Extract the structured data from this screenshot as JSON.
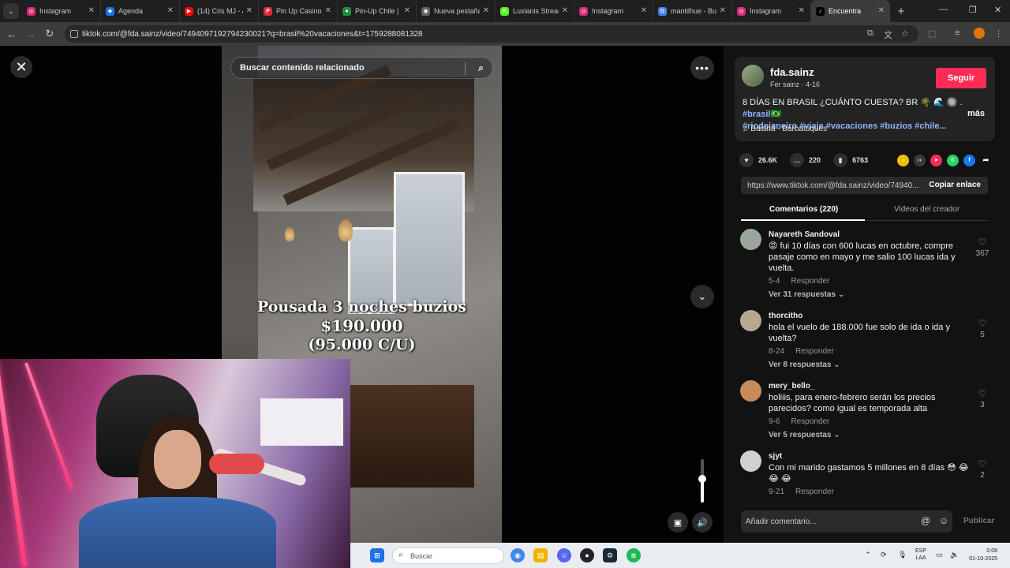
{
  "browser": {
    "tabs": [
      {
        "label": "Instagram",
        "fav_color": "#d62976",
        "fav_glyph": "◎"
      },
      {
        "label": "Agenda",
        "fav_color": "#1a73e8",
        "fav_glyph": "◆"
      },
      {
        "label": "(14) Cris MJ - A",
        "fav_color": "#ff0000",
        "fav_glyph": "▶"
      },
      {
        "label": "Pin Up Casino",
        "fav_color": "#e0283c",
        "fav_glyph": "P"
      },
      {
        "label": "Pin-Up Chile |",
        "fav_color": "#1e8e3e",
        "fav_glyph": "●"
      },
      {
        "label": "Nueva pestaña",
        "fav_color": "#5f6368",
        "fav_glyph": "◉"
      },
      {
        "label": "Luxianis Stream",
        "fav_color": "#53fc18",
        "fav_glyph": "K"
      },
      {
        "label": "Instagram",
        "fav_color": "#d62976",
        "fav_glyph": "◎"
      },
      {
        "label": "mantilhue - Bu",
        "fav_color": "#4285f4",
        "fav_glyph": "G"
      },
      {
        "label": "Instagram",
        "fav_color": "#d62976",
        "fav_glyph": "◎"
      },
      {
        "label": "Encuentra",
        "fav_color": "#000000",
        "fav_glyph": "♪"
      }
    ],
    "url": "tiktok.com/@fda.sainz/video/7494097192794230021?q=brasil%20vacaciones&t=1759288081328"
  },
  "video": {
    "search_placeholder": "Buscar contenido relacionado",
    "overlay_line1": "Pousada 3 noches buzios",
    "overlay_line2": "$190.000",
    "overlay_line3": "(95.000 C/U)",
    "volume_level": 0.55
  },
  "post": {
    "author": "fda.sainz",
    "author_sub": "Fer sainz · 4-16",
    "follow_label": "Seguir",
    "desc_text": "8 DÍAS EN BRASIL ¿CUÁNTO CUESTA? ",
    "desc_flag": "BR 🌴 🌊 🔘 . ",
    "tags_line1": "#brasil🇧🇷",
    "tags_line2": "#riodejaneiro #viaje #vacaciones #buzios #chile...",
    "more": "más",
    "music": "♫  Baianá - Barbatuques",
    "likes": "26.6K",
    "comments_count": "220",
    "saves": "6763",
    "share_link": "https://www.tiktok.com/@fda.sainz/video/74940...",
    "copy_label": "Copiar enlace",
    "tab_comments": "Comentarios (220)",
    "tab_videos": "Videos del creador"
  },
  "comments": [
    {
      "user": "Nayareth Sandoval",
      "text": "😡 fui 10 días con 600 lucas en octubre, compre pasaje como en mayo y me salio 100 lucas ida y vuelta.",
      "date": "5-4",
      "reply": "Responder",
      "replies": "Ver 31 respuestas ⌄",
      "likes": "367",
      "av": "#9aa69a"
    },
    {
      "user": "thorcitho",
      "text": "hola el vuelo de 188.000 fue solo de ida o ida y vuelta?",
      "date": "8-24",
      "reply": "Responder",
      "replies": "Ver 8 respuestas ⌄",
      "likes": "5",
      "av": "#b8a890"
    },
    {
      "user": "mery_bello_",
      "text": "holiiis, para enero-febrero serán los precios parecidos? como igual es temporada alta",
      "date": "9-6",
      "reply": "Responder",
      "replies": "Ver 5 respuestas ⌄",
      "likes": "3",
      "av": "#c88a5a"
    },
    {
      "user": "sjyt",
      "text": "Con mi marido gastamos 5 millones en 8 días 😳 😂 😂 😂",
      "date": "9-21",
      "reply": "Responder",
      "replies": "",
      "likes": "2",
      "av": "#d0d0d0"
    }
  ],
  "composer": {
    "placeholder": "Añadir comentario...",
    "publish": "Publicar"
  },
  "taskbar": {
    "search": "Buscar",
    "lang1": "ESP",
    "lang2": "LAA",
    "time": "0:08",
    "date": "01-10-2025"
  }
}
